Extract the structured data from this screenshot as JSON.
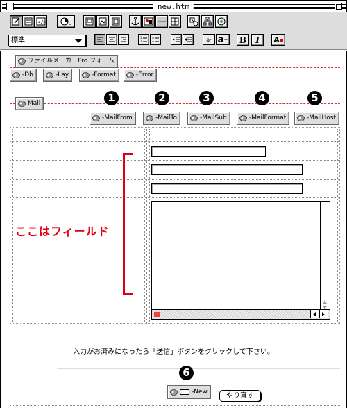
{
  "window": {
    "title": "new.htm"
  },
  "toolbar": {
    "style_select": "標準",
    "font_smaller": "a",
    "font_larger": "a",
    "bold": "B",
    "italic": "I",
    "color_label": "A"
  },
  "form_components": {
    "form_label": "ファイルメーカーPro フォーム",
    "row1": [
      "-Db",
      "-Lay",
      "-Format",
      "-Error"
    ],
    "mail_label": "Mail",
    "mail_buttons": [
      "-MailFrom",
      "-MailTo",
      "-MailSub",
      "-MailFormat",
      "-MailHost"
    ],
    "numbers": [
      "1",
      "2",
      "3",
      "4",
      "5",
      "6"
    ],
    "new_label": "-New"
  },
  "annotation": {
    "field_note": "ここはフィールド",
    "bracket_color": "#e00010"
  },
  "footer": {
    "instruction": "入力がお済みになったら「送信」ボタンをクリックして下さい。",
    "reset_label": "やり直す"
  },
  "colors": {
    "form_line": "#c9333a",
    "annotation": "#e00010"
  }
}
